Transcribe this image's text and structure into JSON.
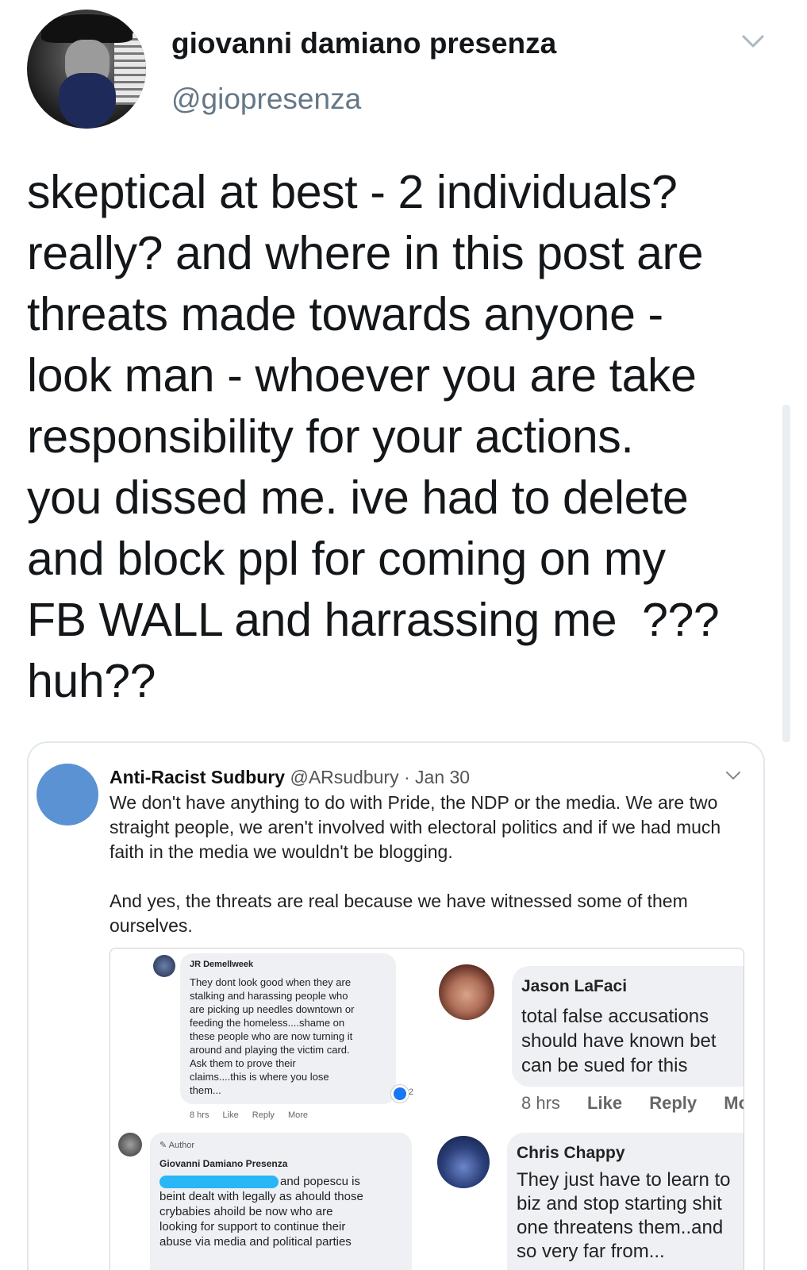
{
  "author": {
    "name": "giovanni damiano presenza",
    "handle": "@giopresenza"
  },
  "tweet": {
    "lines": [
      "skeptical at best - 2 individuals?",
      "really? and where in this post are",
      "threats made towards anyone -",
      "look man - whoever you are take",
      "responsibility for your actions.",
      "you dissed me. ive had to delete",
      "and block ppl for coming on my",
      "FB WALL and harrassing me  ???",
      "huh??"
    ]
  },
  "quoted": {
    "name": "Anti-Racist Sudbury",
    "handle": "@ARsudbury",
    "separator": "·",
    "date": "Jan 30",
    "paragraph1": [
      "We don't have anything to do with Pride, the NDP or the media. We are two",
      "straight people, we aren't involved with electoral politics and if we had much",
      "faith in the media we wouldn't be blogging."
    ],
    "paragraph2": [
      "And yes, the threats are real because we have witnessed some of them",
      "ourselves."
    ],
    "comments": {
      "c1": {
        "name": "JR Demellweek",
        "lines": [
          "They dont look good when they are",
          "stalking and harassing people who",
          "are picking up needles downtown or",
          "feeding the homeless....shame on",
          "these people who are now turning it",
          "around and playing the victim card.",
          "Ask them to prove their",
          "claims....this is where you lose",
          "them..."
        ],
        "time": "8 hrs",
        "like": "Like",
        "reply": "Reply",
        "more": "More",
        "reactions": "2"
      },
      "c2": {
        "name": "Jason LaFaci",
        "lines": [
          "total false accusations",
          "should have known bet",
          "can be sued for this"
        ],
        "time": "8 hrs",
        "like": "Like",
        "reply": "Reply",
        "more": "Mo"
      },
      "c3": {
        "badge": "Author",
        "name": "Giovanni Damiano Presenza",
        "lines": [
          "and popescu is",
          "beint dealt with legally as ahould those",
          "crybabies ahoild be now who are",
          "looking for support to continue their",
          "abuse via media and political parties"
        ]
      },
      "c4": {
        "name": "Chris Chappy",
        "lines": [
          "They just have to learn to",
          "biz and stop starting shit",
          "one threatens them..and",
          "so very far from..."
        ]
      }
    }
  },
  "colors": {
    "handle": "#657786",
    "border": "#e1e8ed",
    "quoted_avatar": "#5b92d3",
    "highlight": "#29b6f6"
  },
  "icons": [
    "chevron-down-icon",
    "author-pen-icon",
    "reaction-badge-icon"
  ]
}
